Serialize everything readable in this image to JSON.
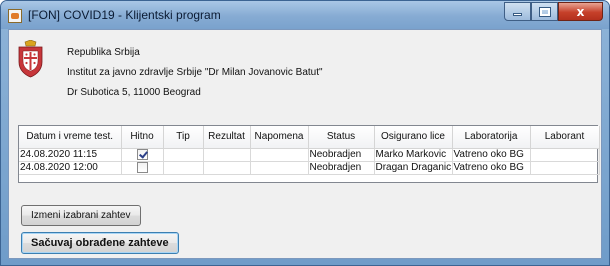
{
  "window": {
    "title": "[FON] COVID19 - Klijentski program",
    "controls": {
      "minimize_icon": "minimize-icon",
      "maximize_icon": "maximize-icon",
      "close_label": "x"
    }
  },
  "header": {
    "line1": "Republika Srbija",
    "line2": "Institut za javno zdravlje Srbije \"Dr Milan Jovanovic Batut\"",
    "line3": "Dr Subotica 5, 11000 Beograd",
    "crest_icon": "serbia-coat-of-arms-icon"
  },
  "table": {
    "columns": [
      "Datum i vreme test.",
      "Hitno",
      "Tip",
      "Rezultat",
      "Napomena",
      "Status",
      "Osigurano lice",
      "Laboratorija",
      "Laborant"
    ],
    "rows": [
      {
        "datum": "24.08.2020 11:15",
        "hitno": true,
        "tip": "",
        "rezultat": "",
        "napomena": "",
        "status": "Neobradjen",
        "osigurano_lice": "Marko Markovic",
        "laboratorija": "Vatreno oko BG",
        "laborant": ""
      },
      {
        "datum": "24.08.2020 12:00",
        "hitno": false,
        "tip": "",
        "rezultat": "",
        "napomena": "",
        "status": "Neobradjen",
        "osigurano_lice": "Dragan Draganic",
        "laboratorija": "Vatreno oko BG",
        "laborant": ""
      }
    ]
  },
  "buttons": {
    "edit_label": "Izmeni izabrani zahtev",
    "save_label": "Sačuvaj obrađene zahteve"
  }
}
